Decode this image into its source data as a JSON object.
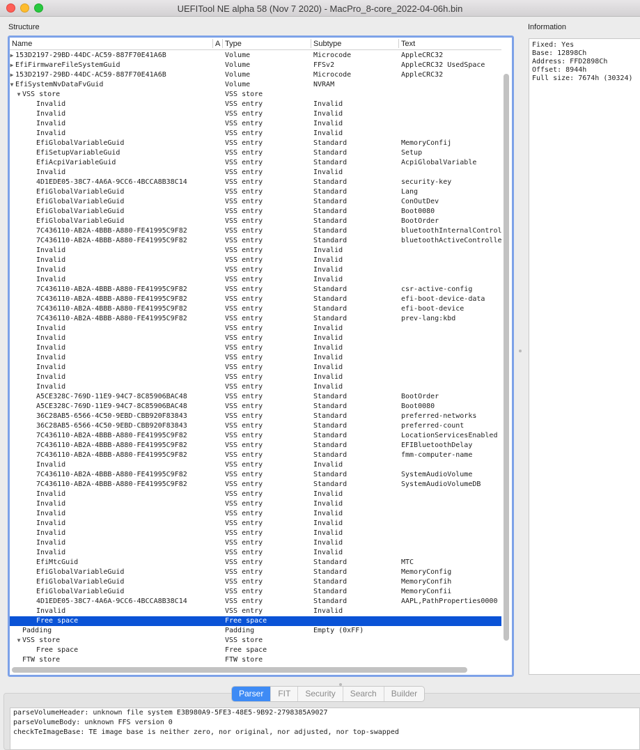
{
  "window": {
    "title": "UEFITool NE alpha 58 (Nov  7 2020) - MacPro_8-core_2022-04-06h.bin"
  },
  "structure_label": "Structure",
  "information_label": "Information",
  "columns": {
    "name": "Name",
    "a": "A",
    "type": "Type",
    "subtype": "Subtype",
    "text": "Text"
  },
  "rows": [
    {
      "name": "153D2197-29BD-44DC-AC59-887F70E41A6B",
      "type": "Volume",
      "subtype": "Microcode",
      "text": "AppleCRC32",
      "depth": 0,
      "toggle": "▶"
    },
    {
      "name": "EfiFirmwareFileSystemGuid",
      "type": "Volume",
      "subtype": "FFSv2",
      "text": "AppleCRC32 UsedSpace",
      "depth": 0,
      "toggle": "▶"
    },
    {
      "name": "153D2197-29BD-44DC-AC59-887F70E41A6B",
      "type": "Volume",
      "subtype": "Microcode",
      "text": "AppleCRC32",
      "depth": 0,
      "toggle": "▶"
    },
    {
      "name": "EfiSystemNvDataFvGuid",
      "type": "Volume",
      "subtype": "NVRAM",
      "text": "",
      "depth": 0,
      "toggle": "▼"
    },
    {
      "name": "VSS store",
      "type": "VSS store",
      "subtype": "",
      "text": "",
      "depth": 1,
      "toggle": "▼"
    },
    {
      "name": "Invalid",
      "type": "VSS entry",
      "subtype": "Invalid",
      "text": "",
      "depth": 2
    },
    {
      "name": "Invalid",
      "type": "VSS entry",
      "subtype": "Invalid",
      "text": "",
      "depth": 2
    },
    {
      "name": "Invalid",
      "type": "VSS entry",
      "subtype": "Invalid",
      "text": "",
      "depth": 2
    },
    {
      "name": "Invalid",
      "type": "VSS entry",
      "subtype": "Invalid",
      "text": "",
      "depth": 2
    },
    {
      "name": "EfiGlobalVariableGuid",
      "type": "VSS entry",
      "subtype": "Standard",
      "text": "MemoryConfij",
      "depth": 2
    },
    {
      "name": "EfiSetupVariableGuid",
      "type": "VSS entry",
      "subtype": "Standard",
      "text": "Setup",
      "depth": 2
    },
    {
      "name": "EfiAcpiVariableGuid",
      "type": "VSS entry",
      "subtype": "Standard",
      "text": "AcpiGlobalVariable",
      "depth": 2
    },
    {
      "name": "Invalid",
      "type": "VSS entry",
      "subtype": "Invalid",
      "text": "",
      "depth": 2
    },
    {
      "name": "4D1EDE05-38C7-4A6A-9CC6-4BCCA8B38C14",
      "type": "VSS entry",
      "subtype": "Standard",
      "text": "security-key",
      "depth": 2
    },
    {
      "name": "EfiGlobalVariableGuid",
      "type": "VSS entry",
      "subtype": "Standard",
      "text": "Lang",
      "depth": 2
    },
    {
      "name": "EfiGlobalVariableGuid",
      "type": "VSS entry",
      "subtype": "Standard",
      "text": "ConOutDev",
      "depth": 2
    },
    {
      "name": "EfiGlobalVariableGuid",
      "type": "VSS entry",
      "subtype": "Standard",
      "text": "Boot0080",
      "depth": 2
    },
    {
      "name": "EfiGlobalVariableGuid",
      "type": "VSS entry",
      "subtype": "Standard",
      "text": "BootOrder",
      "depth": 2
    },
    {
      "name": "7C436110-AB2A-4BBB-A880-FE41995C9F82",
      "type": "VSS entry",
      "subtype": "Standard",
      "text": "bluetoothInternalControl",
      "depth": 2
    },
    {
      "name": "7C436110-AB2A-4BBB-A880-FE41995C9F82",
      "type": "VSS entry",
      "subtype": "Standard",
      "text": "bluetoothActiveControlle",
      "depth": 2
    },
    {
      "name": "Invalid",
      "type": "VSS entry",
      "subtype": "Invalid",
      "text": "",
      "depth": 2
    },
    {
      "name": "Invalid",
      "type": "VSS entry",
      "subtype": "Invalid",
      "text": "",
      "depth": 2
    },
    {
      "name": "Invalid",
      "type": "VSS entry",
      "subtype": "Invalid",
      "text": "",
      "depth": 2
    },
    {
      "name": "Invalid",
      "type": "VSS entry",
      "subtype": "Invalid",
      "text": "",
      "depth": 2
    },
    {
      "name": "7C436110-AB2A-4BBB-A880-FE41995C9F82",
      "type": "VSS entry",
      "subtype": "Standard",
      "text": "csr-active-config",
      "depth": 2
    },
    {
      "name": "7C436110-AB2A-4BBB-A880-FE41995C9F82",
      "type": "VSS entry",
      "subtype": "Standard",
      "text": "efi-boot-device-data",
      "depth": 2
    },
    {
      "name": "7C436110-AB2A-4BBB-A880-FE41995C9F82",
      "type": "VSS entry",
      "subtype": "Standard",
      "text": "efi-boot-device",
      "depth": 2
    },
    {
      "name": "7C436110-AB2A-4BBB-A880-FE41995C9F82",
      "type": "VSS entry",
      "subtype": "Standard",
      "text": "prev-lang:kbd",
      "depth": 2
    },
    {
      "name": "Invalid",
      "type": "VSS entry",
      "subtype": "Invalid",
      "text": "",
      "depth": 2
    },
    {
      "name": "Invalid",
      "type": "VSS entry",
      "subtype": "Invalid",
      "text": "",
      "depth": 2
    },
    {
      "name": "Invalid",
      "type": "VSS entry",
      "subtype": "Invalid",
      "text": "",
      "depth": 2
    },
    {
      "name": "Invalid",
      "type": "VSS entry",
      "subtype": "Invalid",
      "text": "",
      "depth": 2
    },
    {
      "name": "Invalid",
      "type": "VSS entry",
      "subtype": "Invalid",
      "text": "",
      "depth": 2
    },
    {
      "name": "Invalid",
      "type": "VSS entry",
      "subtype": "Invalid",
      "text": "",
      "depth": 2
    },
    {
      "name": "Invalid",
      "type": "VSS entry",
      "subtype": "Invalid",
      "text": "",
      "depth": 2
    },
    {
      "name": "A5CE328C-769D-11E9-94C7-8C85906BAC48",
      "type": "VSS entry",
      "subtype": "Standard",
      "text": "BootOrder",
      "depth": 2
    },
    {
      "name": "A5CE328C-769D-11E9-94C7-8C85906BAC48",
      "type": "VSS entry",
      "subtype": "Standard",
      "text": "Boot0080",
      "depth": 2
    },
    {
      "name": "36C28AB5-6566-4C50-9EBD-CBB920F83843",
      "type": "VSS entry",
      "subtype": "Standard",
      "text": "preferred-networks",
      "depth": 2
    },
    {
      "name": "36C28AB5-6566-4C50-9EBD-CBB920F83843",
      "type": "VSS entry",
      "subtype": "Standard",
      "text": "preferred-count",
      "depth": 2
    },
    {
      "name": "7C436110-AB2A-4BBB-A880-FE41995C9F82",
      "type": "VSS entry",
      "subtype": "Standard",
      "text": "LocationServicesEnabled",
      "depth": 2
    },
    {
      "name": "7C436110-AB2A-4BBB-A880-FE41995C9F82",
      "type": "VSS entry",
      "subtype": "Standard",
      "text": "EFIBluetoothDelay",
      "depth": 2
    },
    {
      "name": "7C436110-AB2A-4BBB-A880-FE41995C9F82",
      "type": "VSS entry",
      "subtype": "Standard",
      "text": "fmm-computer-name",
      "depth": 2
    },
    {
      "name": "Invalid",
      "type": "VSS entry",
      "subtype": "Invalid",
      "text": "",
      "depth": 2
    },
    {
      "name": "7C436110-AB2A-4BBB-A880-FE41995C9F82",
      "type": "VSS entry",
      "subtype": "Standard",
      "text": "SystemAudioVolume",
      "depth": 2
    },
    {
      "name": "7C436110-AB2A-4BBB-A880-FE41995C9F82",
      "type": "VSS entry",
      "subtype": "Standard",
      "text": "SystemAudioVolumeDB",
      "depth": 2
    },
    {
      "name": "Invalid",
      "type": "VSS entry",
      "subtype": "Invalid",
      "text": "",
      "depth": 2
    },
    {
      "name": "Invalid",
      "type": "VSS entry",
      "subtype": "Invalid",
      "text": "",
      "depth": 2
    },
    {
      "name": "Invalid",
      "type": "VSS entry",
      "subtype": "Invalid",
      "text": "",
      "depth": 2
    },
    {
      "name": "Invalid",
      "type": "VSS entry",
      "subtype": "Invalid",
      "text": "",
      "depth": 2
    },
    {
      "name": "Invalid",
      "type": "VSS entry",
      "subtype": "Invalid",
      "text": "",
      "depth": 2
    },
    {
      "name": "Invalid",
      "type": "VSS entry",
      "subtype": "Invalid",
      "text": "",
      "depth": 2
    },
    {
      "name": "Invalid",
      "type": "VSS entry",
      "subtype": "Invalid",
      "text": "",
      "depth": 2
    },
    {
      "name": "EfiMtcGuid",
      "type": "VSS entry",
      "subtype": "Standard",
      "text": "MTC",
      "depth": 2
    },
    {
      "name": "EfiGlobalVariableGuid",
      "type": "VSS entry",
      "subtype": "Standard",
      "text": "MemoryConfig",
      "depth": 2
    },
    {
      "name": "EfiGlobalVariableGuid",
      "type": "VSS entry",
      "subtype": "Standard",
      "text": "MemoryConfih",
      "depth": 2
    },
    {
      "name": "EfiGlobalVariableGuid",
      "type": "VSS entry",
      "subtype": "Standard",
      "text": "MemoryConfii",
      "depth": 2
    },
    {
      "name": "4D1EDE05-38C7-4A6A-9CC6-4BCCA8B38C14",
      "type": "VSS entry",
      "subtype": "Standard",
      "text": "AAPL,PathProperties0000",
      "depth": 2
    },
    {
      "name": "Invalid",
      "type": "VSS entry",
      "subtype": "Invalid",
      "text": "",
      "depth": 2
    },
    {
      "name": "Free space",
      "type": "Free space",
      "subtype": "",
      "text": "",
      "depth": 2,
      "selected": true
    },
    {
      "name": "Padding",
      "type": "Padding",
      "subtype": "Empty (0xFF)",
      "text": "",
      "depth": 1
    },
    {
      "name": "VSS store",
      "type": "VSS store",
      "subtype": "",
      "text": "",
      "depth": 1,
      "toggle": "▼"
    },
    {
      "name": "Free space",
      "type": "Free space",
      "subtype": "",
      "text": "",
      "depth": 2
    },
    {
      "name": "FTW store",
      "type": "FTW store",
      "subtype": "",
      "text": "",
      "depth": 1
    }
  ],
  "information": {
    "lines": [
      "Fixed: Yes",
      "Base: 12898Ch",
      "Address: FFD2898Ch",
      "Offset: 8944h",
      "Full size: 7674h (30324)"
    ]
  },
  "tabs": [
    {
      "label": "Parser",
      "active": true
    },
    {
      "label": "FIT",
      "active": false
    },
    {
      "label": "Security",
      "active": false
    },
    {
      "label": "Search",
      "active": false
    },
    {
      "label": "Builder",
      "active": false
    }
  ],
  "messages": [
    "parseVolumeHeader: unknown file system E3B980A9-5FE3-48E5-9B92-2798385A9027",
    "parseVolumeBody: unknown FFS version 0",
    "checkTeImageBase: TE image base is neither zero, nor original, nor adjusted, nor top-swapped"
  ],
  "colors": {
    "selection": "#0a53d6",
    "focus_ring": "#7da2e8",
    "active_tab": "#3e8bf5"
  }
}
